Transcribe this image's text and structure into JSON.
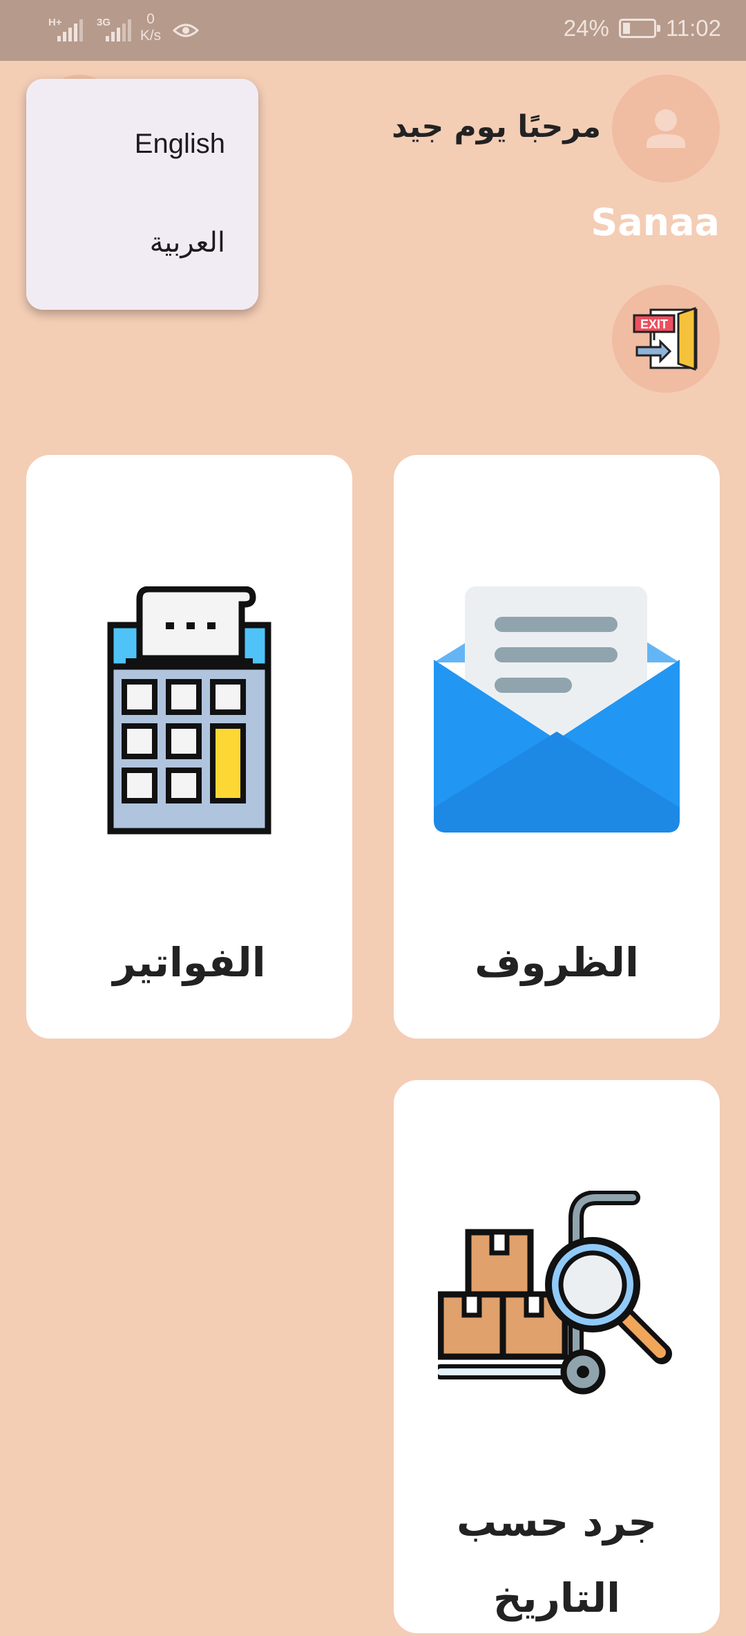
{
  "status_bar": {
    "network_1": "H+",
    "network_2": "3G",
    "speed_value": "0",
    "speed_unit": "K/s",
    "battery_percent": "24%",
    "battery_level": 0.24,
    "time": "11:02"
  },
  "header": {
    "greeting": "مرحبًا يوم جيد",
    "username": "Sanaa",
    "avatar_icon": "person-icon",
    "exit_icon": "exit-door-icon"
  },
  "language_menu": {
    "options": [
      "English",
      "العربية"
    ]
  },
  "cards": {
    "envelopes": {
      "label": "الظروف",
      "icon": "envelope-icon"
    },
    "invoices": {
      "label": "الفواتير",
      "icon": "calculator-icon"
    },
    "inventory": {
      "label": "جرد حسب التاريخ",
      "icon": "inventory-search-icon"
    }
  },
  "colors": {
    "background": "#F4CDB5",
    "status_bar": "#B69A8C",
    "circle": "#F0BCA2",
    "card": "#FFFFFF"
  }
}
